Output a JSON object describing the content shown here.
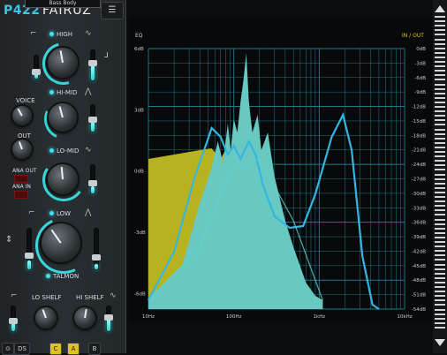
{
  "plugin": {
    "code": "P422",
    "name": "FAIRUZ",
    "preset": "Bass Body"
  },
  "bands": {
    "high": "HIGH",
    "hi_mid": "HI-MID",
    "lo_mid": "LO-MID",
    "low": "LOW",
    "lo_shelf": "LO SHELF",
    "hi_shelf": "HI SHELF"
  },
  "controls": {
    "voice": "VOICE",
    "out": "OUT",
    "ana_out": "ANA OUT",
    "ana_in": "ANA IN",
    "talmon": "TALMON"
  },
  "bottom_bar": {
    "b1": "⊙",
    "b2": "DS",
    "a": "A",
    "b": "B",
    "c": "C"
  },
  "graph": {
    "left_title": "EQ",
    "right_title": "IN / OUT",
    "left_ticks": [
      "6dB",
      "3dB",
      "0dB",
      "-3dB",
      "-6dB"
    ],
    "right_ticks": [
      "0dB",
      "-3dB",
      "-6dB",
      "-9dB",
      "-12dB",
      "-15dB",
      "-18dB",
      "-21dB",
      "-24dB",
      "-27dB",
      "-30dB",
      "-33dB",
      "-36dB",
      "-39dB",
      "-42dB",
      "-45dB",
      "-48dB",
      "-51dB",
      "-54dB"
    ],
    "x_ticks": [
      "10Hz",
      "100Hz",
      "1kHz",
      "10kHz"
    ],
    "colors": {
      "grid": "#1f7b8c",
      "in_spectrum": "#b7b320",
      "out_spectrum": "#68c9c2",
      "eq_curve": "#35b6e0",
      "accent": "#e8c000"
    }
  },
  "icons": {
    "spectrum": "spectrum-bars-icon",
    "menu": "menu-icon"
  }
}
